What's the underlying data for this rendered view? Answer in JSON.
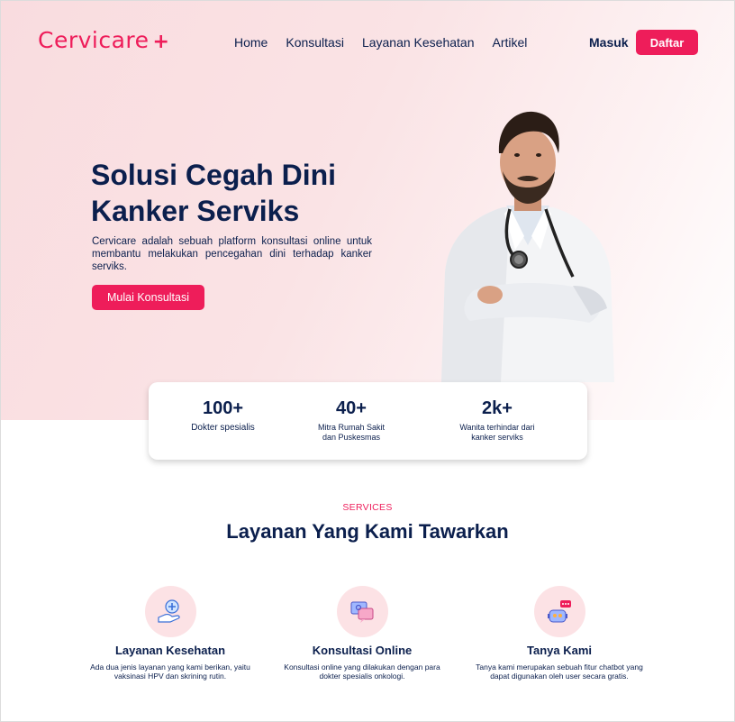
{
  "brand": {
    "name": "Cervicare",
    "plus": "+",
    "color": "#ee1d5a"
  },
  "nav": {
    "items": [
      "Home",
      "Konsultasi",
      "Layanan Kesehatan",
      "Artikel"
    ],
    "login": "Masuk",
    "register": "Daftar"
  },
  "hero": {
    "title": "Solusi Cegah Dini Kanker Serviks",
    "description": "Cervicare adalah sebuah platform konsultasi online untuk membantu melakukan pencegahan dini terhadap kanker serviks.",
    "cta": "Mulai Konsultasi"
  },
  "stats": [
    {
      "value": "100+",
      "label": "Dokter spesialis"
    },
    {
      "value": "40+",
      "label": "Mitra Rumah Sakit dan Puskesmas"
    },
    {
      "value": "2k+",
      "label": "Wanita terhindar dari kanker serviks"
    }
  ],
  "services": {
    "kicker": "SERVICES",
    "title": "Layanan Yang Kami Tawarkan",
    "items": [
      {
        "icon": "health-care-hand-icon",
        "name": "Layanan Kesehatan",
        "desc": "Ada dua jenis layanan yang kami berikan, yaitu vaksinasi HPV dan skrining rutin."
      },
      {
        "icon": "chat-bubbles-icon",
        "name": "Konsultasi Online",
        "desc": "Konsultasi online yang dilakukan dengan para dokter spesialis onkologi."
      },
      {
        "icon": "chatbot-robot-icon",
        "name": "Tanya Kami",
        "desc": "Tanya kami merupakan sebuah fitur chatbot yang dapat digunakan oleh user secara gratis."
      }
    ]
  }
}
